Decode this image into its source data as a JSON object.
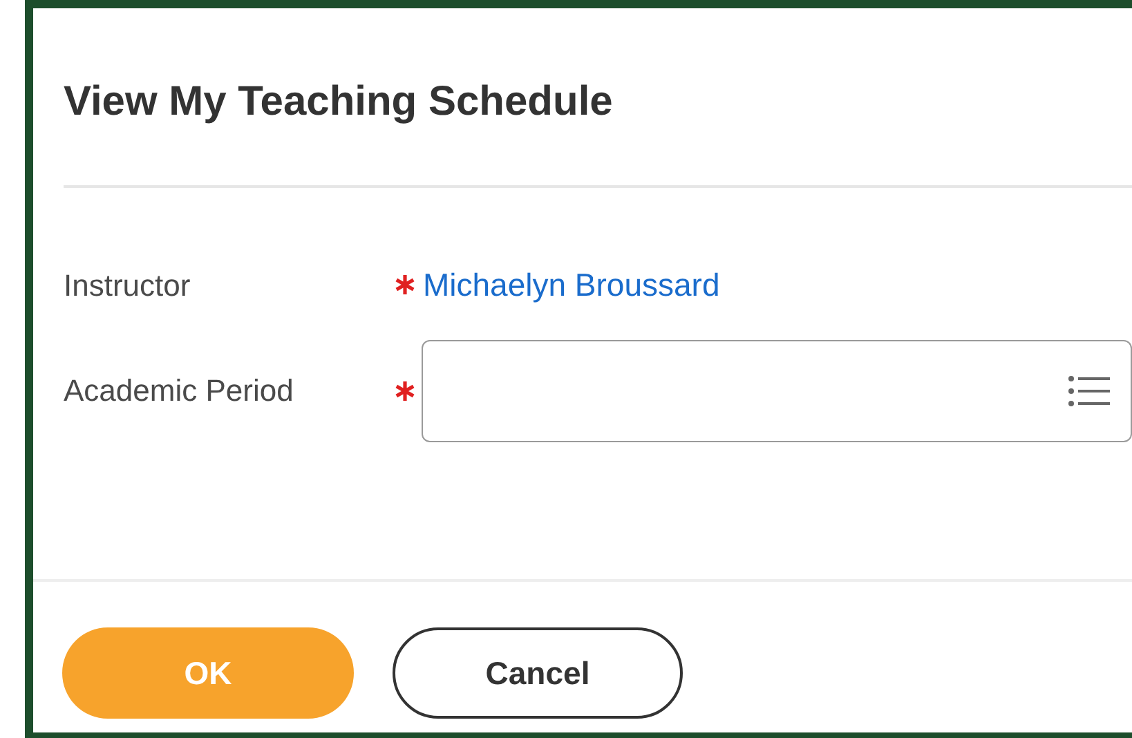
{
  "title": "View My Teaching Schedule",
  "fields": [
    {
      "label": "Instructor",
      "required": true,
      "kind": "link",
      "value": "Michaelyn Broussard"
    },
    {
      "label": "Academic Period",
      "required": true,
      "kind": "prompt"
    }
  ],
  "buttons": [
    {
      "label": "OK",
      "kind": "primary"
    },
    {
      "label": "Cancel",
      "kind": "secondary"
    }
  ]
}
